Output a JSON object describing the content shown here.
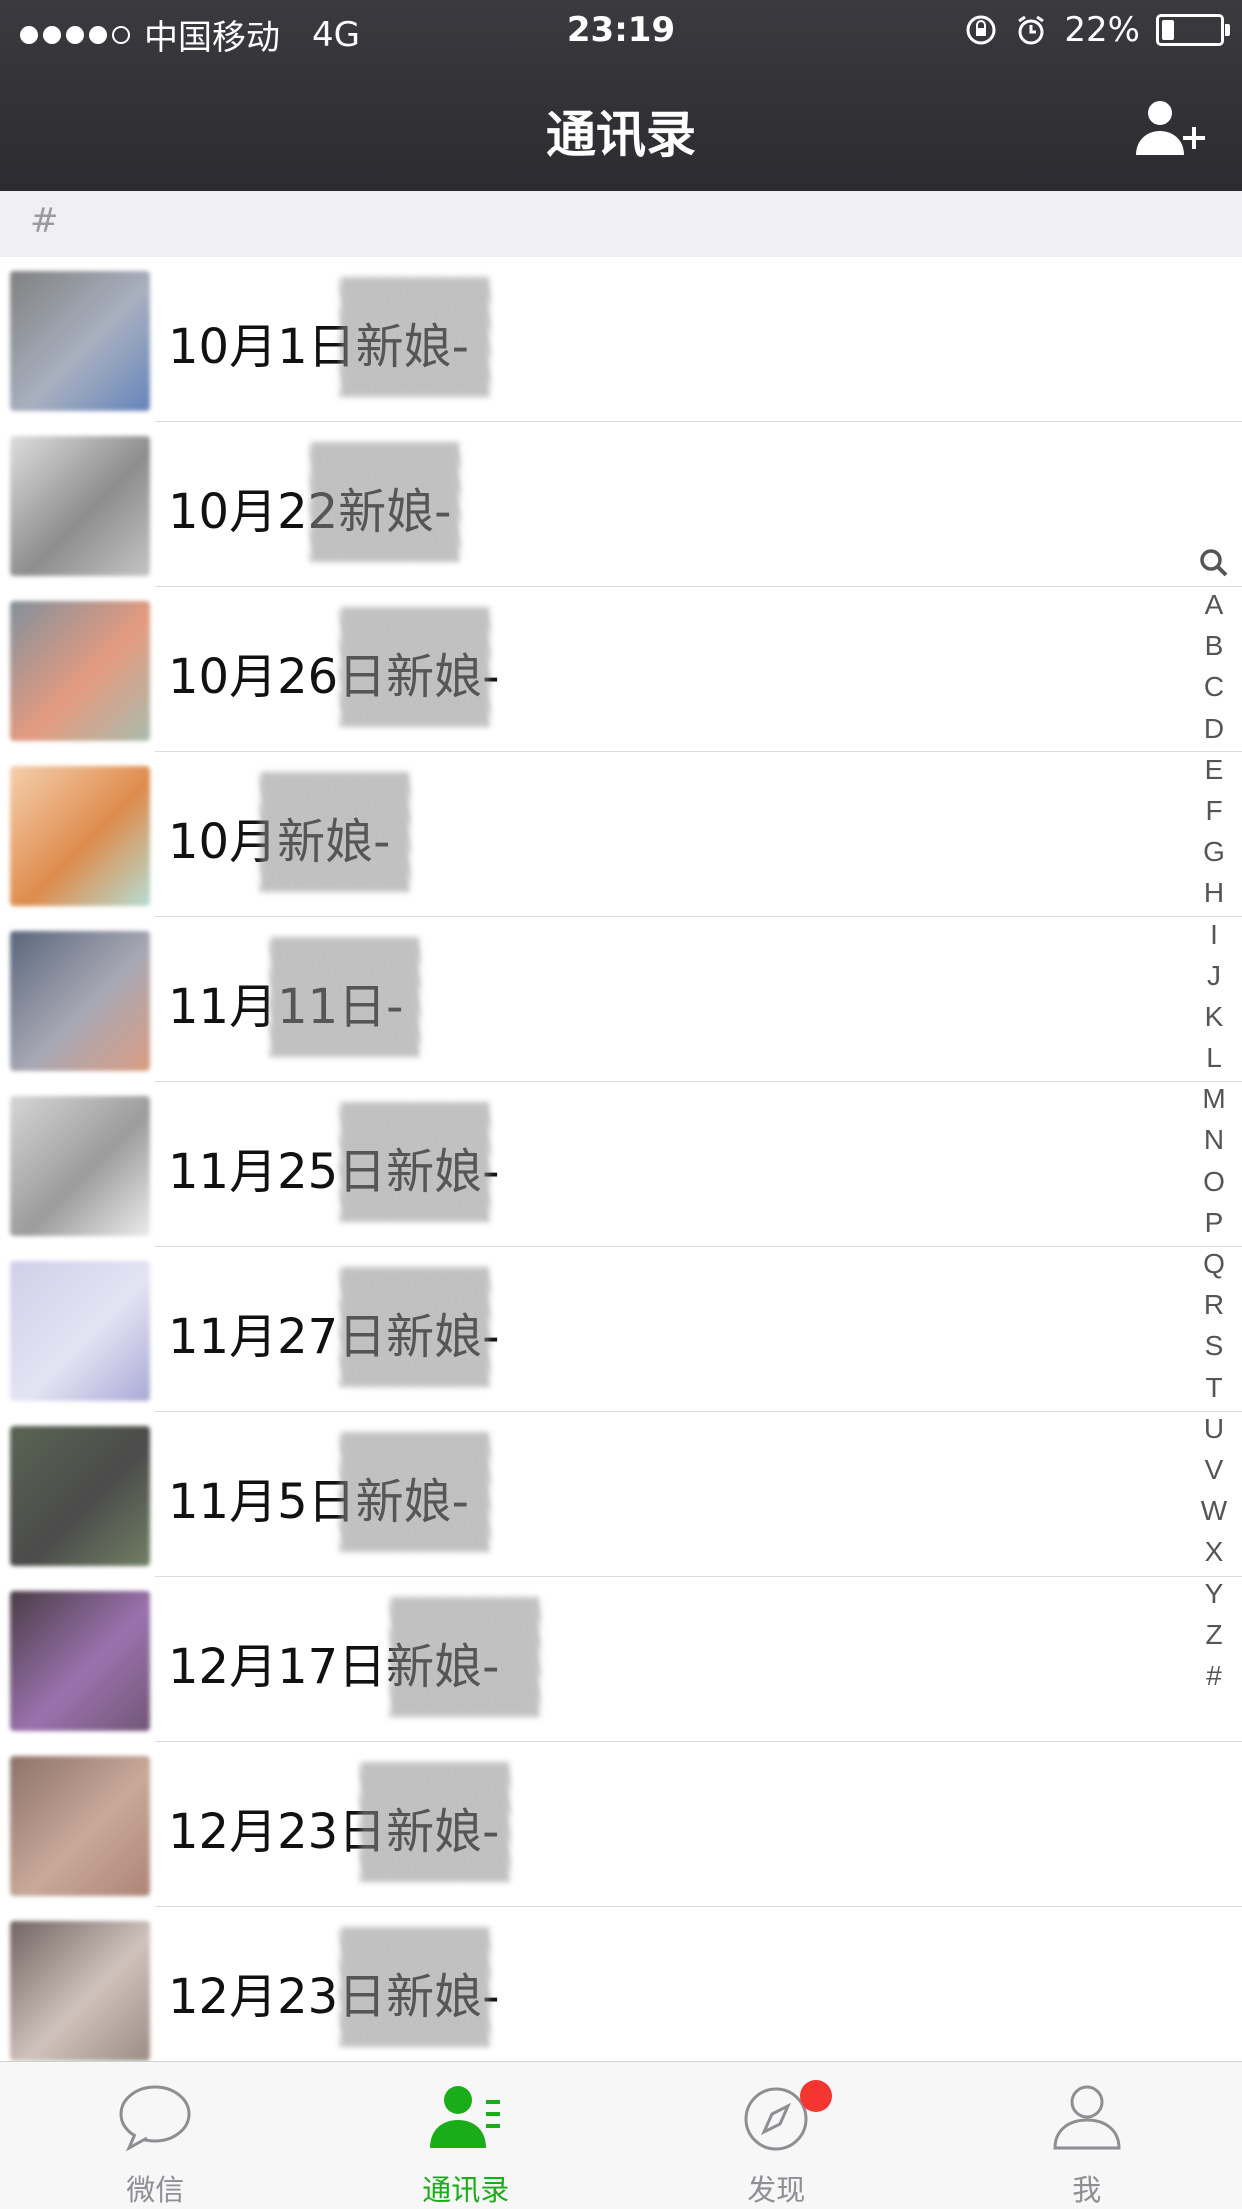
{
  "status_bar": {
    "carrier": "中国移动",
    "network": "4G",
    "time": "23:19",
    "battery_percent": "22%",
    "battery_level": 0.22,
    "signal_bars": 4
  },
  "nav": {
    "title": "通讯录",
    "add_contact_icon": "add-person-icon"
  },
  "section": {
    "header": "#"
  },
  "contacts": [
    {
      "name": "10月1日新娘-"
    },
    {
      "name": "10月22新娘-"
    },
    {
      "name": "10月26日新娘-"
    },
    {
      "name": "10月新娘-"
    },
    {
      "name": "11月11日-"
    },
    {
      "name": "11月25日新娘-"
    },
    {
      "name": "11月27日新娘-"
    },
    {
      "name": "11月5日新娘-"
    },
    {
      "name": "12月17日新娘-"
    },
    {
      "name": "12月23日新娘-"
    },
    {
      "name": "12月23日新娘-"
    }
  ],
  "index_bar": [
    "A",
    "B",
    "C",
    "D",
    "E",
    "F",
    "G",
    "H",
    "I",
    "J",
    "K",
    "L",
    "M",
    "N",
    "O",
    "P",
    "Q",
    "R",
    "S",
    "T",
    "U",
    "V",
    "W",
    "X",
    "Y",
    "Z",
    "#"
  ],
  "tabs": [
    {
      "label": "微信",
      "icon": "chat-bubble-icon",
      "active": false
    },
    {
      "label": "通讯录",
      "icon": "contacts-icon",
      "active": true
    },
    {
      "label": "发现",
      "icon": "compass-icon",
      "active": false,
      "badge": true
    },
    {
      "label": "我",
      "icon": "person-icon",
      "active": false
    }
  ],
  "colors": {
    "accent": "#1aad19",
    "badge": "#f43530",
    "nav_bg": "#2e2e33"
  }
}
